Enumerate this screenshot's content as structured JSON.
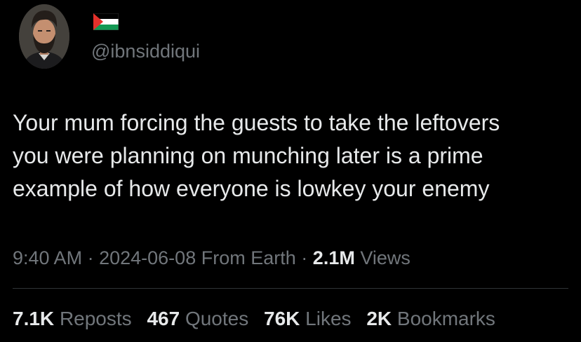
{
  "tweet": {
    "handle": "@ibnsiddiqui",
    "flag_icon": "palestine-flag-icon",
    "text": "Your mum forcing the guests to take the leftovers\nyou were planning on munching later is a prime\nexample of how everyone is lowkey your enemy",
    "time": "9:40 AM",
    "date": "2024-06-08",
    "source": "From Earth",
    "separator": "·",
    "views_count": "2.1M",
    "views_label": "Views"
  },
  "stats": {
    "reposts": {
      "count": "7.1K",
      "label": "Reposts"
    },
    "quotes": {
      "count": "467",
      "label": "Quotes"
    },
    "likes": {
      "count": "76K",
      "label": "Likes"
    },
    "bookmarks": {
      "count": "2K",
      "label": "Bookmarks"
    }
  },
  "colors": {
    "background": "#000000",
    "primary_text": "#e7e9ea",
    "secondary_text": "#71767b",
    "divider": "#2f3336"
  }
}
